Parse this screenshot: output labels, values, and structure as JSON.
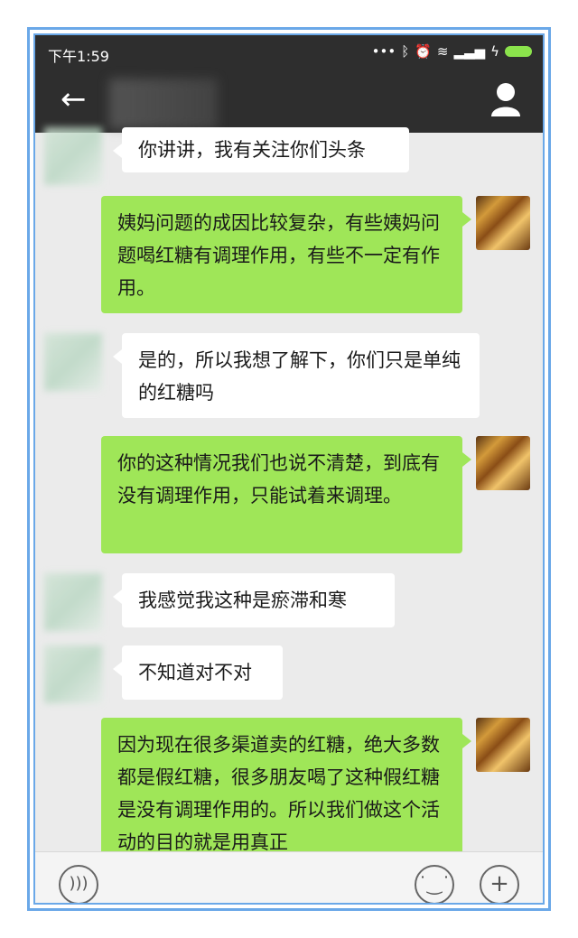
{
  "statusbar": {
    "time": "下午1:59",
    "icons": [
      "more-dots-icon",
      "bluetooth-icon",
      "alarm-icon",
      "wifi-icon",
      "signal-icon",
      "battery-icon"
    ]
  },
  "titlebar": {
    "back_icon": "back-arrow-icon",
    "profile_icon": "person-icon"
  },
  "messages": [
    {
      "side": "left",
      "text": "你讲讲，我有关注你们头条"
    },
    {
      "side": "right",
      "text": "姨妈问题的成因比较复杂，有些姨妈问题喝红糖有调理作用，有些不一定有作用。"
    },
    {
      "side": "left",
      "text": "是的，所以我想了解下，你们只是单纯的红糖吗"
    },
    {
      "side": "right",
      "text": "你的这种情况我们也说不清楚，到底有没有调理作用，只能试着来调理。"
    },
    {
      "side": "left",
      "text": "我感觉我这种是瘀滞和寒"
    },
    {
      "side": "left",
      "text": "不知道对不对"
    },
    {
      "side": "right",
      "text": "因为现在很多渠道卖的红糖，绝大多数都是假红糖，很多朋友喝了这种假红糖是没有调理作用的。所以我们做这个活动的目的就是用真正"
    }
  ],
  "inputbar": {
    "voice_icon": "voice-icon",
    "emoji_icon": "emoji-icon",
    "plus_icon": "plus-icon"
  },
  "colors": {
    "frame": "#6aa8e8",
    "header": "#2e2e2e",
    "chat_bg": "#ebebeb",
    "sent_bubble": "#9fe658",
    "received_bubble": "#ffffff"
  }
}
